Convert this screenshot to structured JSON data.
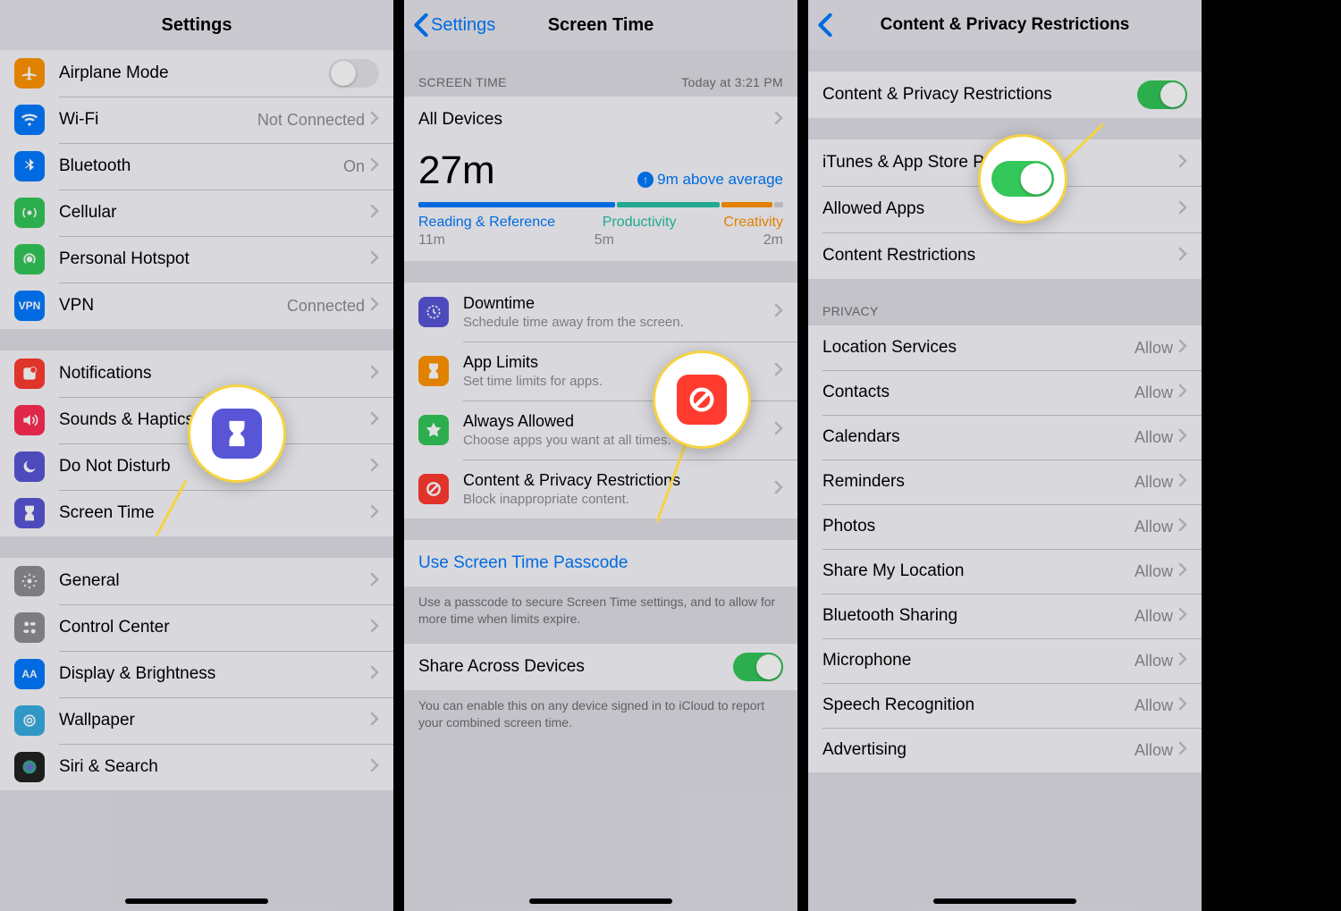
{
  "panel1": {
    "title": "Settings",
    "groups": [
      {
        "items": [
          {
            "icon": "airplane-icon",
            "bg": "#ff9500",
            "label": "Airplane Mode",
            "type": "toggle",
            "on": false
          },
          {
            "icon": "wifi-icon",
            "bg": "#007aff",
            "label": "Wi-Fi",
            "detail": "Not Connected",
            "type": "nav"
          },
          {
            "icon": "bluetooth-icon",
            "bg": "#007aff",
            "label": "Bluetooth",
            "detail": "On",
            "type": "nav"
          },
          {
            "icon": "cellular-icon",
            "bg": "#34c759",
            "label": "Cellular",
            "type": "nav"
          },
          {
            "icon": "hotspot-icon",
            "bg": "#34c759",
            "label": "Personal Hotspot",
            "type": "nav"
          },
          {
            "icon": "vpn-icon",
            "bg": "#007aff",
            "label": "VPN",
            "detail": "Connected",
            "type": "nav"
          }
        ]
      },
      {
        "items": [
          {
            "icon": "notifications-icon",
            "bg": "#ff3b30",
            "label": "Notifications",
            "type": "nav"
          },
          {
            "icon": "sounds-icon",
            "bg": "#ff2d55",
            "label": "Sounds & Haptics",
            "type": "nav"
          },
          {
            "icon": "dnd-icon",
            "bg": "#5856d6",
            "label": "Do Not Disturb",
            "type": "nav"
          },
          {
            "icon": "screentime-icon",
            "bg": "#5856d6",
            "label": "Screen Time",
            "type": "nav"
          }
        ]
      },
      {
        "items": [
          {
            "icon": "general-icon",
            "bg": "#8e8e93",
            "label": "General",
            "type": "nav"
          },
          {
            "icon": "controlcenter-icon",
            "bg": "#8e8e93",
            "label": "Control Center",
            "type": "nav"
          },
          {
            "icon": "display-icon",
            "bg": "#007aff",
            "label": "Display & Brightness",
            "type": "nav"
          },
          {
            "icon": "wallpaper-icon",
            "bg": "#37aee2",
            "label": "Wallpaper",
            "type": "nav"
          },
          {
            "icon": "siri-icon",
            "bg": "#222",
            "label": "Siri & Search",
            "type": "nav"
          }
        ]
      }
    ]
  },
  "panel2": {
    "back": "Settings",
    "title": "Screen Time",
    "summary_header": "SCREEN TIME",
    "summary_time": "Today at 3:21 PM",
    "all_devices": "All Devices",
    "total": "27m",
    "trend": "9m above average",
    "categories": [
      {
        "name": "Reading & Reference",
        "value": "11m",
        "color": "#007aff",
        "w": 54
      },
      {
        "name": "Productivity",
        "value": "5m",
        "color": "#26c1a6",
        "w": 28
      },
      {
        "name": "Creativity",
        "value": "2m",
        "color": "#ff9500",
        "w": 14
      }
    ],
    "options": [
      {
        "icon": "downtime-icon",
        "bg": "#5856d6",
        "title": "Downtime",
        "sub": "Schedule time away from the screen."
      },
      {
        "icon": "applimits-icon",
        "bg": "#ff9500",
        "title": "App Limits",
        "sub": "Set time limits for apps."
      },
      {
        "icon": "always-icon",
        "bg": "#34c759",
        "title": "Always Allowed",
        "sub": "Choose apps you want at all times."
      },
      {
        "icon": "restrictions-icon",
        "bg": "#ff3b30",
        "title": "Content & Privacy Restrictions",
        "sub": "Block inappropriate content."
      }
    ],
    "passcode": "Use Screen Time Passcode",
    "passcode_note": "Use a passcode to secure Screen Time settings, and to allow for more time when limits expire.",
    "share": "Share Across Devices",
    "share_on": true,
    "share_note": "You can enable this on any device signed in to iCloud to report your combined screen time."
  },
  "panel3": {
    "title": "Content & Privacy Restrictions",
    "main_toggle": "Content & Privacy Restrictions",
    "main_on": true,
    "rows": [
      "iTunes & App Store Purchases",
      "Allowed Apps",
      "Content Restrictions"
    ],
    "privacy_header": "PRIVACY",
    "privacy": [
      {
        "label": "Location Services",
        "value": "Allow"
      },
      {
        "label": "Contacts",
        "value": "Allow"
      },
      {
        "label": "Calendars",
        "value": "Allow"
      },
      {
        "label": "Reminders",
        "value": "Allow"
      },
      {
        "label": "Photos",
        "value": "Allow"
      },
      {
        "label": "Share My Location",
        "value": "Allow"
      },
      {
        "label": "Bluetooth Sharing",
        "value": "Allow"
      },
      {
        "label": "Microphone",
        "value": "Allow"
      },
      {
        "label": "Speech Recognition",
        "value": "Allow"
      },
      {
        "label": "Advertising",
        "value": "Allow"
      }
    ]
  },
  "chart_data": {
    "type": "bar",
    "title": "Screen Time — Today",
    "total_minutes": 27,
    "trend_minutes_above_average": 9,
    "categories": [
      "Reading & Reference",
      "Productivity",
      "Creativity"
    ],
    "values": [
      11,
      5,
      2
    ],
    "unit": "minutes"
  }
}
